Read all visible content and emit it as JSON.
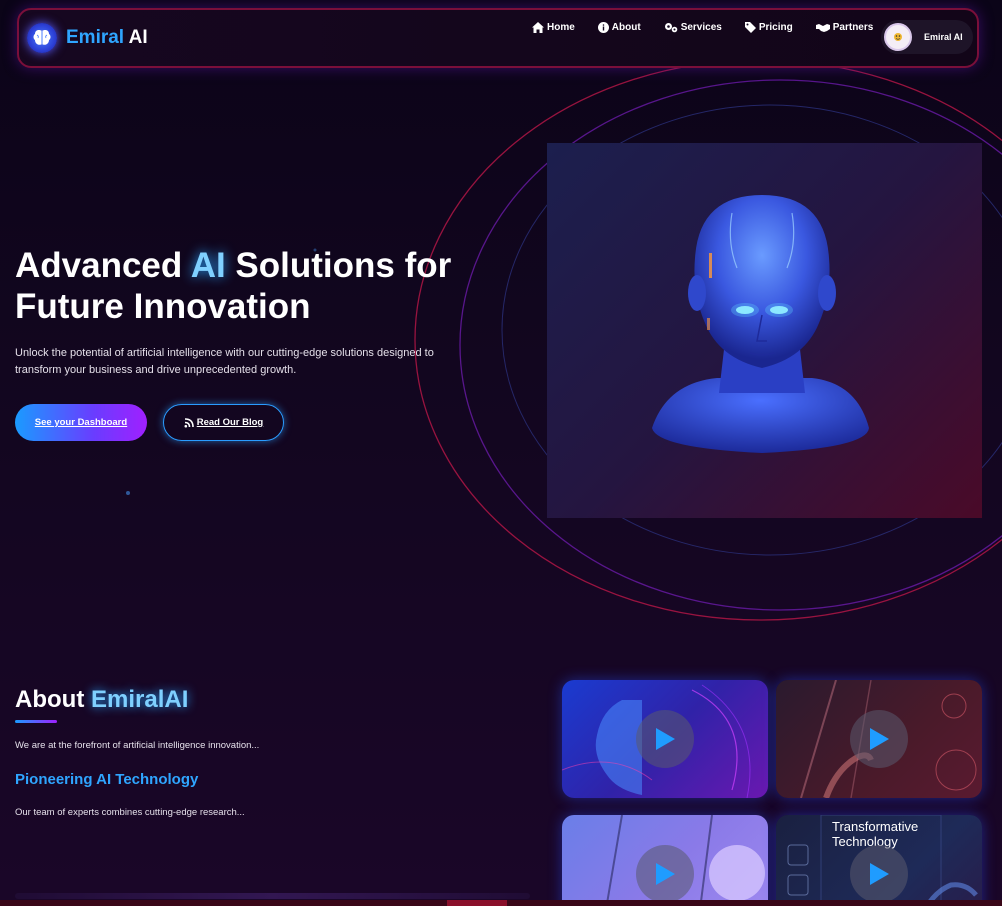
{
  "brand": {
    "accent": "Emiral",
    "rest": "AI"
  },
  "nav": {
    "links": [
      {
        "label": "Home",
        "icon": "home-icon"
      },
      {
        "label": "About",
        "icon": "info-icon"
      },
      {
        "label": "Services",
        "icon": "gears-icon"
      },
      {
        "label": "Pricing",
        "icon": "tag-icon"
      },
      {
        "label": "Partners",
        "icon": "handshake-icon"
      }
    ],
    "user_name": "Emiral AI"
  },
  "hero": {
    "title_part1": "Advanced ",
    "title_accent": "AI",
    "title_part2": " Solutions for",
    "title_line2": "Future Innovation",
    "description": "Unlock the potential of artificial intelligence with our cutting-edge solutions designed to transform your business and drive unprecedented growth.",
    "primary_button": "See your Dashboard",
    "secondary_button": "Read Our Blog"
  },
  "about": {
    "title_part1": "About ",
    "title_accent": "EmiralAI",
    "intro": "We are at the forefront of artificial intelligence innovation...",
    "subtitle": "Pioneering AI Technology",
    "body": "Our team of experts combines cutting-edge research..."
  },
  "videos": [
    {
      "title": ""
    },
    {
      "title": ""
    },
    {
      "title": ""
    },
    {
      "title": "Transformative Technology"
    }
  ],
  "colors": {
    "accent_blue": "#2fa5ff",
    "accent_purple": "#a020ff",
    "background": "#0b0418",
    "border_red": "#7a0f3a"
  }
}
